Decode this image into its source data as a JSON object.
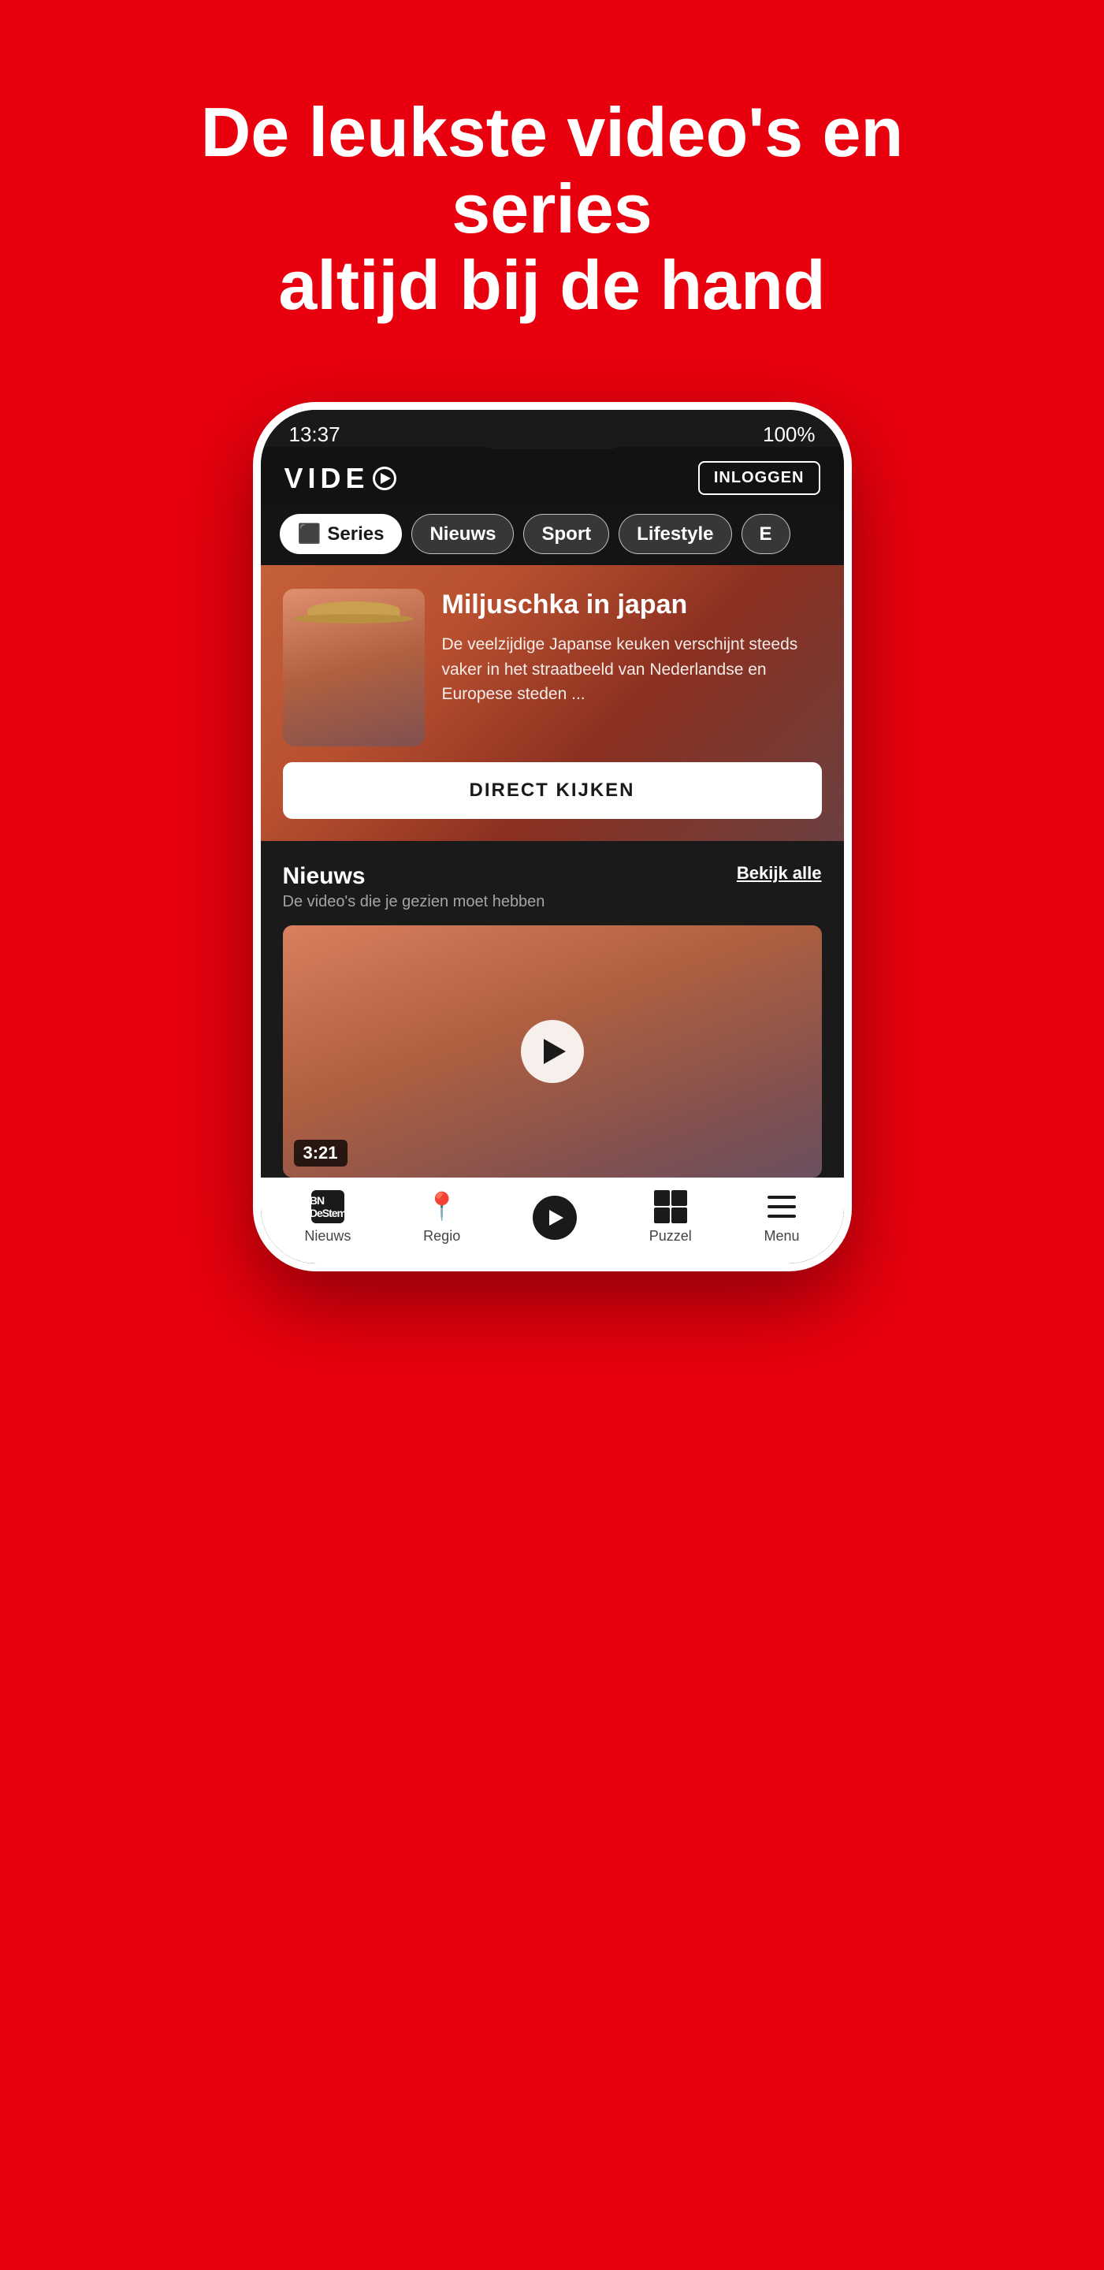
{
  "page": {
    "background_color": "#e8000e"
  },
  "hero": {
    "headline_line1": "De leukste video's en series",
    "headline_line2": "altijd bij de hand"
  },
  "phone": {
    "status_bar": {
      "time": "13:37",
      "battery": "100%"
    },
    "app_header": {
      "logo_text": "VIDE",
      "logo_icon": "play-circle",
      "login_button_label": "INLOGGEN"
    },
    "nav_tabs": [
      {
        "id": "series",
        "label": "Series",
        "icon": "tv-icon",
        "active": true
      },
      {
        "id": "nieuws",
        "label": "Nieuws",
        "active": false
      },
      {
        "id": "sport",
        "label": "Sport",
        "active": false
      },
      {
        "id": "lifestyle",
        "label": "Lifestyle",
        "active": false
      },
      {
        "id": "more",
        "label": "E",
        "active": false
      }
    ],
    "featured_video": {
      "title": "Miljuschka in japan",
      "description": "De veelzijdige Japanse keuken verschijnt steeds vaker in het straatbeeld van Nederlandse en Europese steden ...",
      "cta_label": "DIRECT KIJKEN"
    },
    "nieuws_section": {
      "title": "Nieuws",
      "subtitle": "De video's die je gezien moet hebben",
      "bekijk_alle_label": "Bekijk alle",
      "video_duration": "3:21"
    },
    "bottom_nav": [
      {
        "id": "nieuws",
        "label": "Nieuws",
        "icon": "bn-icon"
      },
      {
        "id": "regio",
        "label": "Regio",
        "icon": "location-icon"
      },
      {
        "id": "video",
        "label": "",
        "icon": "play-icon",
        "featured": true
      },
      {
        "id": "puzzel",
        "label": "Puzzel",
        "icon": "puzzle-icon"
      },
      {
        "id": "menu",
        "label": "Menu",
        "icon": "hamburger-icon"
      }
    ]
  }
}
